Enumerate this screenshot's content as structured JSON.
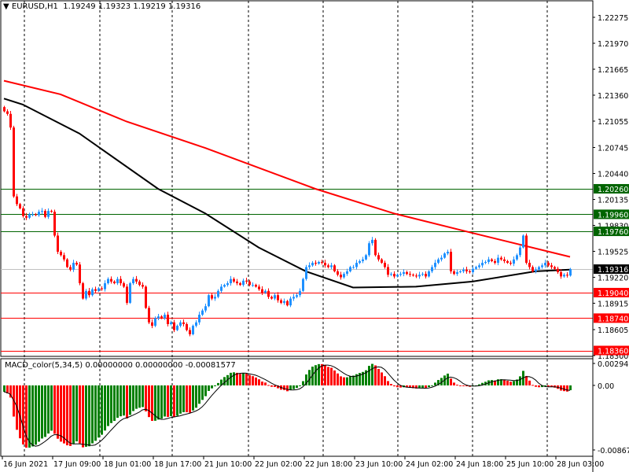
{
  "header": {
    "arrow": "▼",
    "symbol": "EURUSD,H1",
    "open": "1.19249",
    "high": "1.19323",
    "low": "1.19219",
    "close": "1.19316"
  },
  "macd_header": {
    "name": "MACD_color(5,34,5)",
    "v1": "0.00000000",
    "v2": "0.00000000",
    "v3": "-0.00081577"
  },
  "colors": {
    "bull": "#1e90ff",
    "bear": "#ff0000",
    "ma_fast": "#000000",
    "ma_slow": "#ff0000",
    "resistance": "#006400",
    "support": "#ff0000",
    "hist_up": "#008000",
    "hist_down": "#ff0000",
    "current": "#c0c0c0"
  },
  "chart_data": {
    "type": "candlestick",
    "symbol": "EURUSD",
    "timeframe": "H1",
    "ylim": [
      1.183,
      1.22275
    ],
    "price_ticks": [
      "1.22275",
      "1.21970",
      "1.21665",
      "1.21360",
      "1.21055",
      "1.20745",
      "1.20440",
      "1.20135",
      "1.19830",
      "1.19525",
      "1.19220",
      "1.18915",
      "1.18605",
      "1.18300"
    ],
    "time_labels": [
      {
        "bar": 0,
        "label": "16 Jun 2021"
      },
      {
        "bar": 16,
        "label": "17 Jun 09:00"
      },
      {
        "bar": 32,
        "label": "18 Jun 01:00"
      },
      {
        "bar": 48,
        "label": "18 Jun 17:00"
      },
      {
        "bar": 64,
        "label": "21 Jun 10:00"
      },
      {
        "bar": 80,
        "label": "22 Jun 02:00"
      },
      {
        "bar": 96,
        "label": "22 Jun 18:00"
      },
      {
        "bar": 112,
        "label": "23 Jun 10:00"
      },
      {
        "bar": 128,
        "label": "24 Jun 02:00"
      },
      {
        "bar": 144,
        "label": "24 Jun 18:00"
      },
      {
        "bar": 160,
        "label": "25 Jun 10:00"
      },
      {
        "bar": 176,
        "label": "28 Jun 03:00"
      }
    ],
    "first_open": 1.2122,
    "closes": [
      1.2117,
      1.2114,
      1.2098,
      1.2017,
      1.2008,
      1.2003,
      1.1994,
      1.1992,
      1.1996,
      1.1996,
      1.1995,
      1.1999,
      1.2,
      1.1993,
      1.2,
      1.1999,
      1.1971,
      1.1952,
      1.1948,
      1.1943,
      1.1934,
      1.1931,
      1.1939,
      1.1937,
      1.1915,
      1.1897,
      1.1906,
      1.1901,
      1.1908,
      1.1906,
      1.1909,
      1.1908,
      1.1915,
      1.192,
      1.1917,
      1.1915,
      1.192,
      1.1915,
      1.1911,
      1.1892,
      1.1915,
      1.192,
      1.1917,
      1.1913,
      1.1911,
      1.1886,
      1.1869,
      1.1865,
      1.1874,
      1.1876,
      1.1874,
      1.1878,
      1.1867,
      1.1869,
      1.186,
      1.1865,
      1.1869,
      1.1867,
      1.186,
      1.1855,
      1.1865,
      1.1869,
      1.1878,
      1.1883,
      1.1888,
      1.1901,
      1.1897,
      1.1899,
      1.1906,
      1.1911,
      1.1913,
      1.1915,
      1.192,
      1.1917,
      1.1915,
      1.1913,
      1.1918,
      1.1917,
      1.1913,
      1.1913,
      1.1911,
      1.1908,
      1.1904,
      1.1906,
      1.1899,
      1.1897,
      1.1901,
      1.1895,
      1.1892,
      1.1894,
      1.1889,
      1.1897,
      1.1899,
      1.1901,
      1.1906,
      1.192,
      1.1934,
      1.1936,
      1.1939,
      1.1938,
      1.194,
      1.1939,
      1.1936,
      1.1934,
      1.1936,
      1.1929,
      1.1925,
      1.1922,
      1.1926,
      1.1929,
      1.1934,
      1.1934,
      1.1939,
      1.1941,
      1.1943,
      1.1948,
      1.1962,
      1.1966,
      1.1948,
      1.1943,
      1.1939,
      1.1934,
      1.1925,
      1.1926,
      1.1923,
      1.1925,
      1.1926,
      1.1928,
      1.1926,
      1.1925,
      1.1924,
      1.1923,
      1.1925,
      1.1926,
      1.1923,
      1.1929,
      1.1934,
      1.1939,
      1.1943,
      1.1945,
      1.195,
      1.1952,
      1.1929,
      1.1926,
      1.1928,
      1.1929,
      1.1931,
      1.1929,
      1.1928,
      1.1932,
      1.1934,
      1.1936,
      1.1939,
      1.194,
      1.1943,
      1.1941,
      1.1939,
      1.1945,
      1.1943,
      1.1941,
      1.1939,
      1.1938,
      1.1943,
      1.1948,
      1.1957,
      1.1971,
      1.1939,
      1.1934,
      1.1929,
      1.1931,
      1.1934,
      1.1936,
      1.1939,
      1.1936,
      1.1934,
      1.1932,
      1.1928,
      1.1923,
      1.1925,
      1.1924,
      1.19316
    ],
    "ma_fast": [
      [
        0,
        1.2132
      ],
      [
        6,
        1.2125
      ],
      [
        24,
        1.2091
      ],
      [
        49,
        1.2026
      ],
      [
        64,
        1.1997
      ],
      [
        81,
        1.1957
      ],
      [
        96,
        1.1929
      ],
      [
        111,
        1.191
      ],
      [
        131,
        1.1911
      ],
      [
        149,
        1.1917
      ],
      [
        169,
        1.1929
      ],
      [
        180,
        1.1931
      ]
    ],
    "ma_slow": [
      [
        0,
        1.2153
      ],
      [
        18,
        1.2137
      ],
      [
        39,
        1.2105
      ],
      [
        64,
        1.2074
      ],
      [
        99,
        1.2026
      ],
      [
        124,
        1.1997
      ],
      [
        149,
        1.1974
      ],
      [
        180,
        1.1946
      ]
    ],
    "levels": [
      {
        "price": 1.2026,
        "label": "1.20260",
        "kind": "resistance"
      },
      {
        "price": 1.1996,
        "label": "1.19960",
        "kind": "resistance"
      },
      {
        "price": 1.1976,
        "label": "1.19760",
        "kind": "resistance"
      },
      {
        "price": 1.1904,
        "label": "1.19040",
        "kind": "support"
      },
      {
        "price": 1.1874,
        "label": "1.18740",
        "kind": "support"
      },
      {
        "price": 1.1836,
        "label": "1.18360",
        "kind": "support"
      }
    ],
    "current_price": {
      "price": 1.19316,
      "label": "1.19316"
    },
    "macd": {
      "fast": 5,
      "slow": 34,
      "signal": 5,
      "ylim": [
        -0.00867,
        0.0029469
      ],
      "ticks": [
        "0.0029469",
        "0.00",
        "-0.008670"
      ]
    }
  }
}
